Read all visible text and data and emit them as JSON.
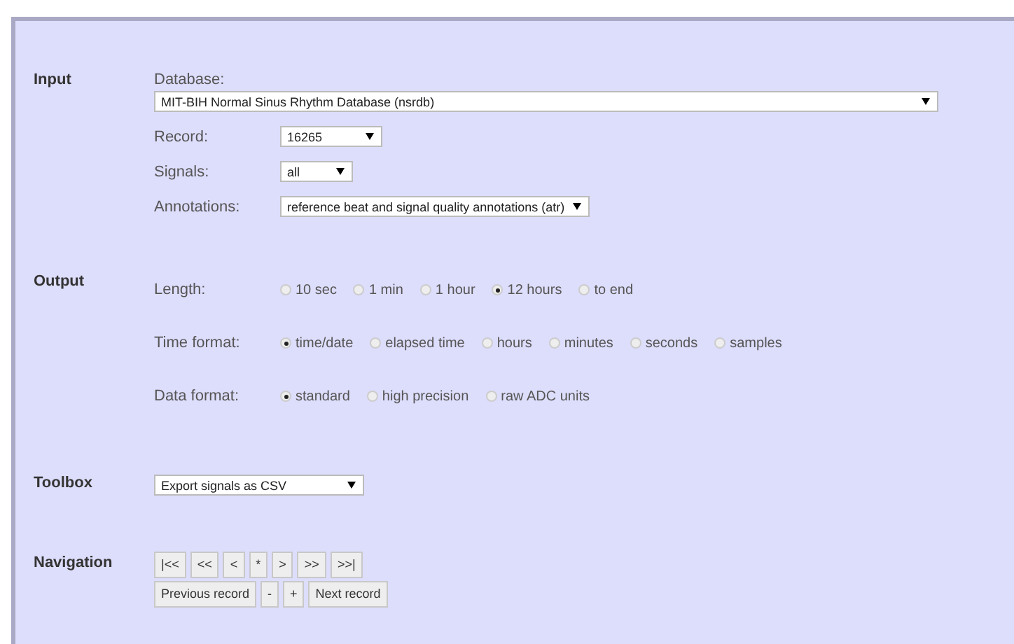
{
  "sections": [
    {
      "title": "Input",
      "rows": [
        {
          "kind": "stacked-select",
          "label": "Database:",
          "value": "MIT-BIH Normal Sinus Rhythm Database (nsrdb)"
        },
        {
          "kind": "select",
          "label": "Record:",
          "value": "16265"
        },
        {
          "kind": "select",
          "label": "Signals:",
          "value": "all"
        },
        {
          "kind": "select",
          "label": "Annotations:",
          "value": "reference beat and signal quality annotations (atr)"
        }
      ]
    },
    {
      "title": "Output",
      "rows": [
        {
          "kind": "radios",
          "label": "Length:",
          "options": [
            {
              "label": "10 sec",
              "selected": false
            },
            {
              "label": "1 min",
              "selected": false
            },
            {
              "label": "1 hour",
              "selected": false
            },
            {
              "label": "12 hours",
              "selected": true
            },
            {
              "label": "to end",
              "selected": false
            }
          ]
        },
        {
          "kind": "radios",
          "label": "Time format:",
          "options": [
            {
              "label": "time/date",
              "selected": true
            },
            {
              "label": "elapsed time",
              "selected": false
            },
            {
              "label": "hours",
              "selected": false
            },
            {
              "label": "minutes",
              "selected": false
            },
            {
              "label": "seconds",
              "selected": false
            },
            {
              "label": "samples",
              "selected": false
            }
          ]
        },
        {
          "kind": "radios",
          "label": "Data format:",
          "options": [
            {
              "label": "standard",
              "selected": true
            },
            {
              "label": "high precision",
              "selected": false
            },
            {
              "label": "raw ADC units",
              "selected": false
            }
          ]
        }
      ]
    },
    {
      "title": "Toolbox",
      "rows": [
        {
          "kind": "bare-select",
          "value": "Export signals as CSV"
        }
      ]
    },
    {
      "title": "Navigation",
      "rows": [
        {
          "kind": "buttons",
          "buttons": [
            "|<<",
            "<<",
            "<",
            "*",
            ">",
            ">>",
            ">>|"
          ]
        },
        {
          "kind": "buttons",
          "buttons": [
            "Previous record",
            "-",
            "+",
            "Next record"
          ]
        }
      ]
    }
  ]
}
